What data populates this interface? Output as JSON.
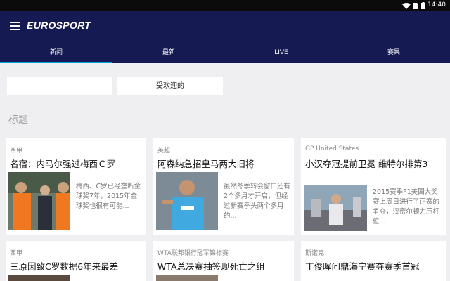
{
  "status": {
    "time": "14:40"
  },
  "app": {
    "title": "EUROSPORT"
  },
  "tabs": [
    "新闻",
    "最新",
    "LIVE",
    "赛果"
  ],
  "filters": [
    {
      "value": ""
    },
    {
      "value": "受欢迎的"
    }
  ],
  "section_title": "标题",
  "cards": [
    {
      "category": "西甲",
      "title": "名宿：内马尔强过梅西Ｃ罗",
      "snippet": "梅西、C罗已经垄断金球奖7年，2015年金球奖也很有可能..."
    },
    {
      "category": "英超",
      "title": "阿森纳急招皇马两大旧将",
      "snippet": "虽然冬季转会窗口还有2个多月才开启，但经过新赛季头两个多月的..."
    },
    {
      "category": "GP United States",
      "title": "小汉夺冠提前卫冕 维特尔排第3",
      "snippet": "2015赛季F1美国大奖赛上周日进行了正赛的争夺，汉密尔顿力压杆位..."
    },
    {
      "category": "西甲",
      "title": "三原因致C罗数据6年来最差",
      "snippet": ""
    },
    {
      "category": "WTA联邦银行冠军锦标赛",
      "title": "WTA总决赛抽签现死亡之组",
      "snippet": ""
    },
    {
      "category": "斯诺克",
      "title": "丁俊晖问鼎海宁赛夺赛季首冠",
      "snippet": ""
    }
  ],
  "colors": {
    "appbar": "#151a52",
    "accent": "#00a3e0",
    "statusbar": "#0b0b0b"
  }
}
